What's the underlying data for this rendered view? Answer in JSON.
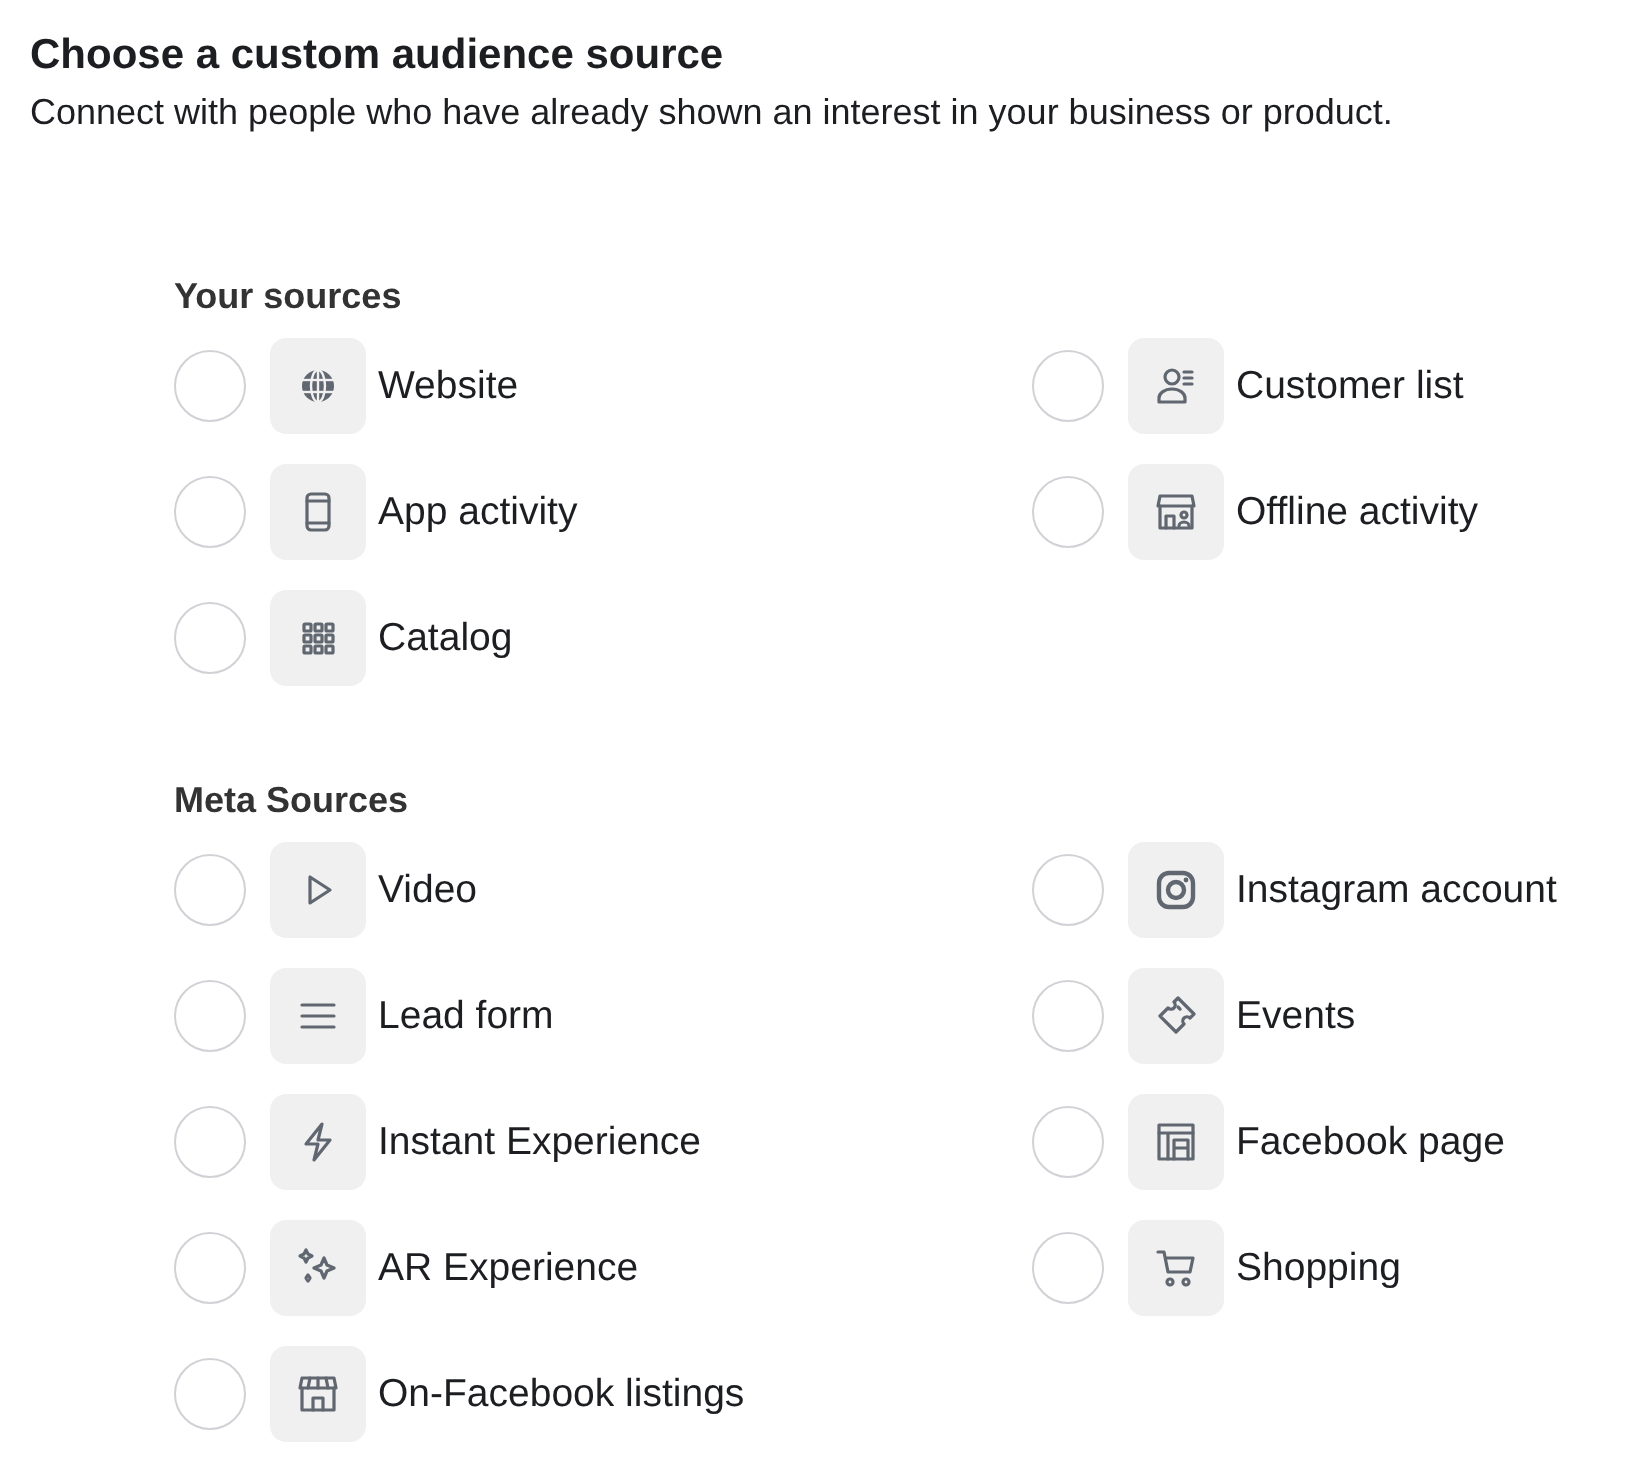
{
  "title": "Choose a custom audience source",
  "subtitle": "Connect with people who have already shown an interest in your business or product.",
  "sections": [
    {
      "heading": "Your sources",
      "options": [
        {
          "label": "Website",
          "kind": "globe",
          "selected": false
        },
        {
          "label": "Customer list",
          "kind": "person-list",
          "selected": false
        },
        {
          "label": "App activity",
          "kind": "phone",
          "selected": false
        },
        {
          "label": "Offline activity",
          "kind": "store-person",
          "selected": false
        },
        {
          "label": "Catalog",
          "kind": "grid",
          "selected": false
        }
      ]
    },
    {
      "heading": "Meta Sources",
      "options": [
        {
          "label": "Video",
          "kind": "play",
          "selected": false
        },
        {
          "label": "Instagram account",
          "kind": "camera",
          "selected": false
        },
        {
          "label": "Lead form",
          "kind": "lines",
          "selected": false
        },
        {
          "label": "Events",
          "kind": "ticket",
          "selected": false
        },
        {
          "label": "Instant Experience",
          "kind": "bolt",
          "selected": false
        },
        {
          "label": "Facebook page",
          "kind": "page",
          "selected": false
        },
        {
          "label": "AR Experience",
          "kind": "sparkles",
          "selected": false
        },
        {
          "label": "Shopping",
          "kind": "cart",
          "selected": false
        },
        {
          "label": "On-Facebook listings",
          "kind": "store",
          "selected": false
        }
      ]
    }
  ]
}
